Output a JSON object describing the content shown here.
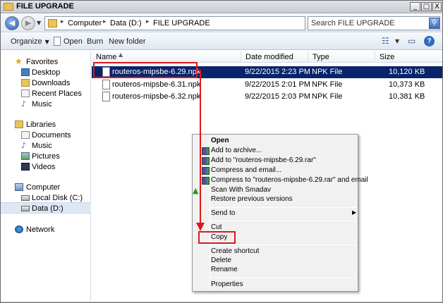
{
  "window": {
    "title": "FILE UPGRADE"
  },
  "window_controls": {
    "minimize": "_",
    "maximize": "□",
    "close": "X"
  },
  "address": {
    "crumbs": [
      "Computer",
      "Data (D:)",
      "FILE UPGRADE"
    ],
    "separator": "▸"
  },
  "search": {
    "placeholder": "Search FILE UPGRADE"
  },
  "toolbar": {
    "organize": "Organize",
    "open": "Open",
    "burn": "Burn",
    "new_folder": "New folder"
  },
  "nav": {
    "favorites": "Favorites",
    "favorite_items": [
      "Desktop",
      "Downloads",
      "Recent Places",
      "Music"
    ],
    "libraries": "Libraries",
    "library_items": [
      "Documents",
      "Music",
      "Pictures",
      "Videos"
    ],
    "computer": "Computer",
    "computer_items": [
      "Local Disk (C:)",
      "Data (D:)"
    ],
    "network": "Network"
  },
  "columns": {
    "name": "Name",
    "date": "Date modified",
    "type": "Type",
    "size": "Size"
  },
  "files": [
    {
      "name": "routeros-mipsbe-6.29.npk",
      "date": "9/22/2015 2:23 PM",
      "type": "NPK File",
      "size": "10,120 KB",
      "selected": true
    },
    {
      "name": "routeros-mipsbe-6.31.npk",
      "date": "9/22/2015 2:01 PM",
      "type": "NPK File",
      "size": "10,373 KB",
      "selected": false
    },
    {
      "name": "routeros-mipsbe-6.32.npk",
      "date": "9/22/2015 2:03 PM",
      "type": "NPK File",
      "size": "10,381 KB",
      "selected": false
    }
  ],
  "context_menu": {
    "open": "Open",
    "add_archive": "Add to archive...",
    "add_rar": "Add to \"routeros-mipsbe-6.29.rar\"",
    "compress_email": "Compress and email...",
    "compress_rar_email": "Compress to \"routeros-mipsbe-6.29.rar\" and email",
    "scan_smadav": "Scan With Smadav",
    "restore": "Restore previous versions",
    "send_to": "Send to",
    "cut": "Cut",
    "copy": "Copy",
    "create_shortcut": "Create shortcut",
    "delete": "Delete",
    "rename": "Rename",
    "properties": "Properties"
  },
  "colors": {
    "selection": "#0a246a",
    "highlight_box": "#e01818"
  }
}
